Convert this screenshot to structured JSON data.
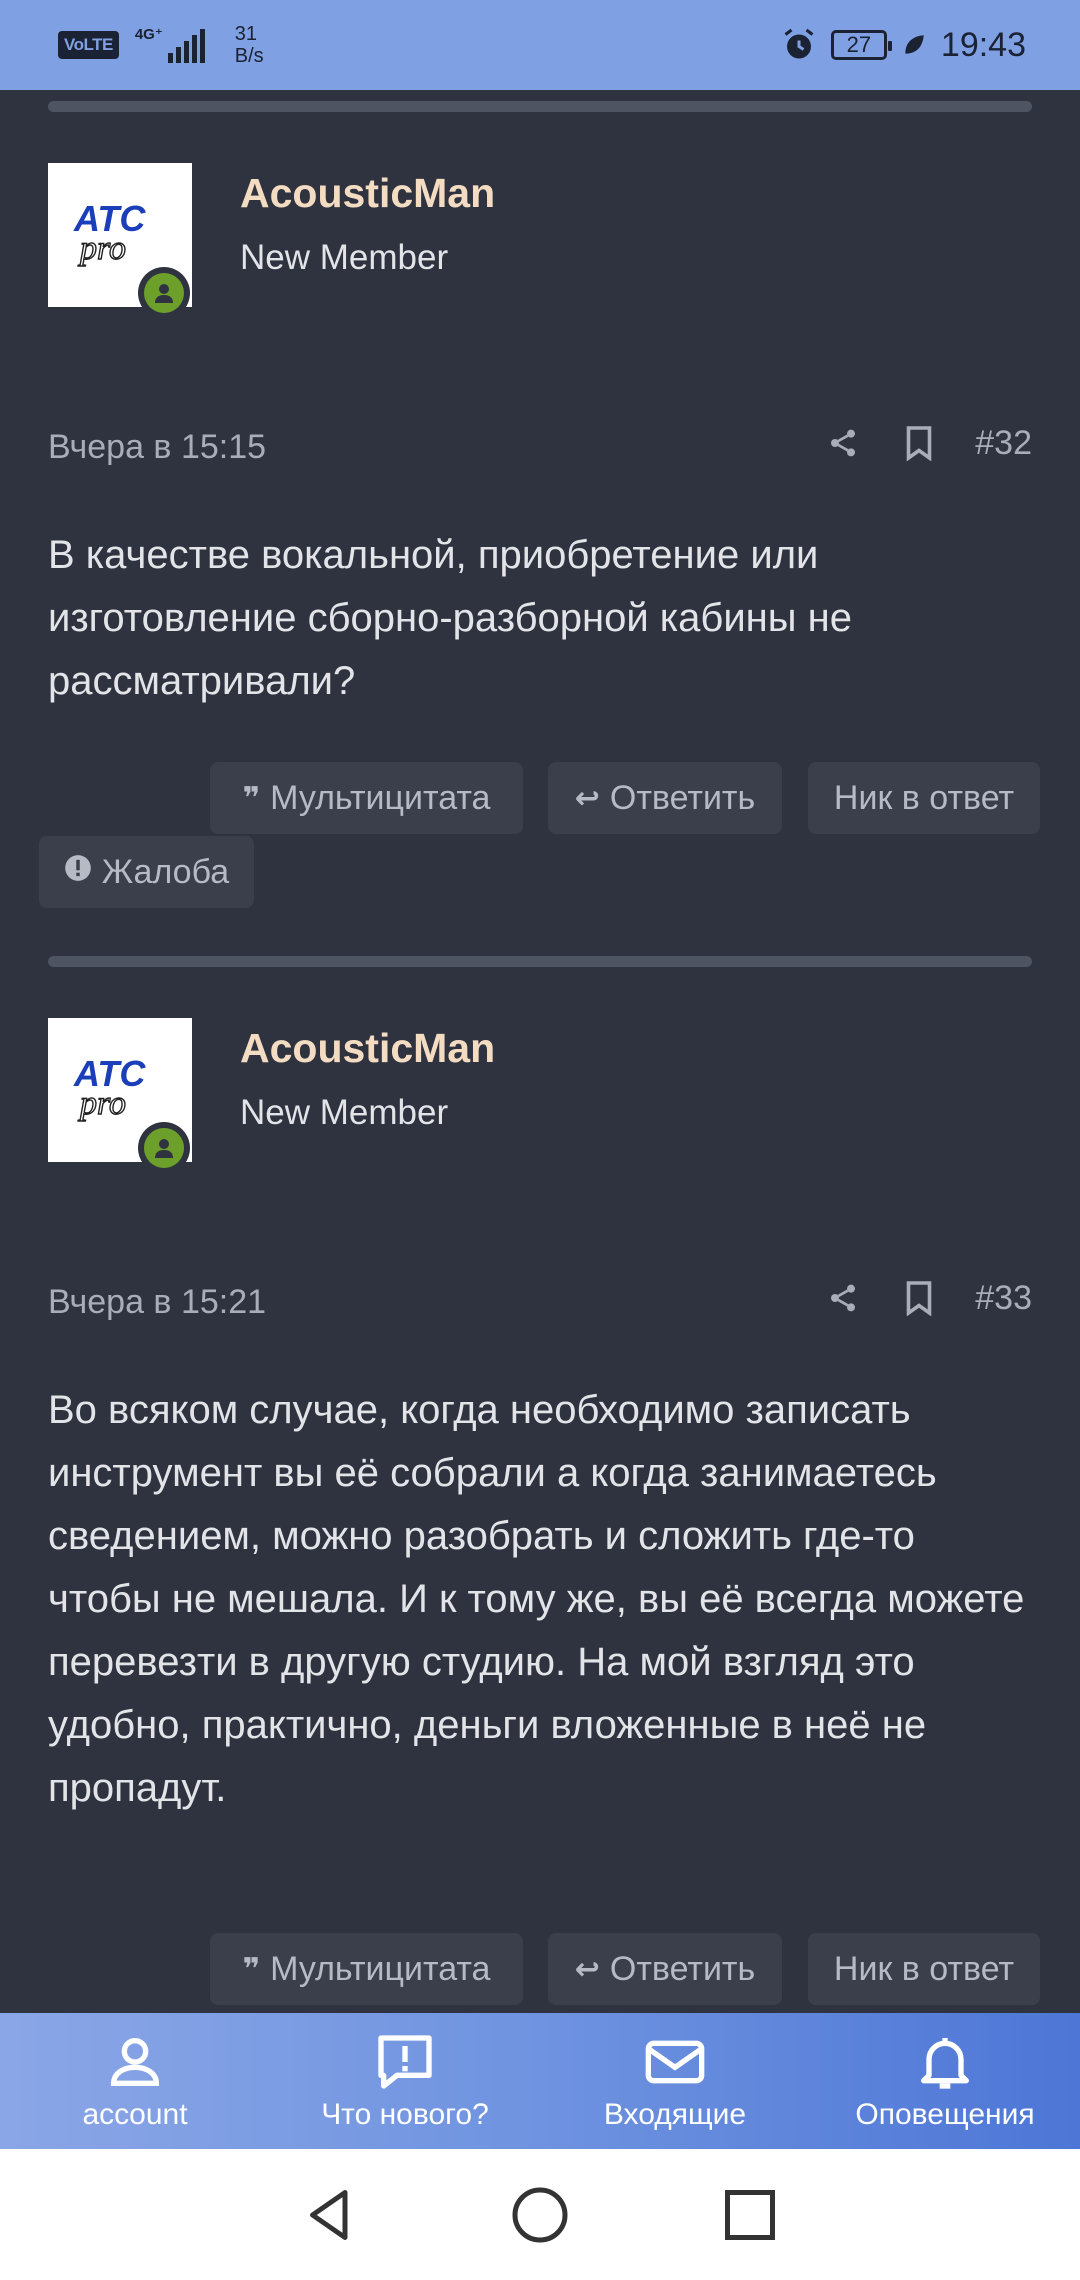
{
  "status_bar": {
    "volte": "VoLTE",
    "network": "4G⁺",
    "speed_value": "31",
    "speed_unit": "B/s",
    "battery": "27",
    "time": "19:43"
  },
  "posts": [
    {
      "username": "AcousticMan",
      "user_title": "New Member",
      "avatar_logo_text": "ATC pro",
      "date": "Вчера в 15:15",
      "number": "#32",
      "body": "В качестве вокальной, приобретение или изготовление сборно-разборной кабины не рассматривали?"
    },
    {
      "username": "AcousticMan",
      "user_title": "New Member",
      "avatar_logo_text": "ATC pro",
      "date": "Вчера в 15:21",
      "number": "#33",
      "body": "Во всяком случае, когда необходимо записать инструмент вы её собрали а когда занимаетесь сведением, можно разобрать и сложить где-то чтобы не мешала. И к тому же, вы её всегда можете перевезти в другую студию. На мой взгляд это удобно, практично, деньги вложенные в неё не пропадут."
    }
  ],
  "post_actions": {
    "multiquote": "Мультицитата",
    "reply": "Ответить",
    "nick_reply": "Ник в ответ",
    "report": "Жалоба"
  },
  "bottom_nav": [
    {
      "label": "account",
      "icon": "user-icon"
    },
    {
      "label": "Что нового?",
      "icon": "news-icon"
    },
    {
      "label": "Входящие",
      "icon": "envelope-icon"
    },
    {
      "label": "Оповещения",
      "icon": "bell-icon"
    }
  ],
  "colors": {
    "background": "#2f3340",
    "status_bar": "#7fa0e2",
    "username": "#f4dcc2",
    "online_badge": "#6ca02b",
    "button_bg": "#3b3f4c"
  }
}
